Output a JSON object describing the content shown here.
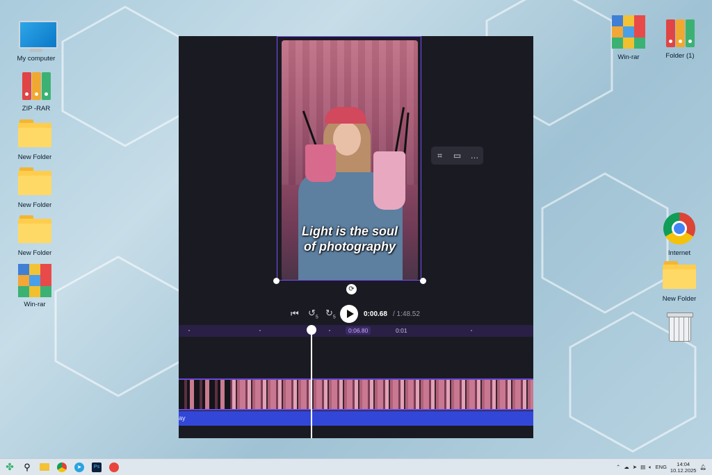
{
  "desktop": {
    "left_icons": [
      {
        "label": "My computer",
        "icon": "computer-icon"
      },
      {
        "label": "ZIP -RAR",
        "icon": "archive-binders-icon"
      },
      {
        "label": "New Folder",
        "icon": "folder-icon"
      },
      {
        "label": "New Folder",
        "icon": "folder-icon"
      },
      {
        "label": "New Folder",
        "icon": "folder-icon"
      },
      {
        "label": "Win-rar",
        "icon": "winrar-icon"
      }
    ],
    "right_icons": [
      {
        "label": "Win-rar",
        "icon": "winrar-icon"
      },
      {
        "label": "Folder (1)",
        "icon": "archive-binders-icon"
      },
      {
        "label": "Internet",
        "icon": "chrome-icon"
      },
      {
        "label": "New Folder",
        "icon": "folder-icon"
      },
      {
        "label": "",
        "icon": "recycle-bin-icon"
      }
    ]
  },
  "editor": {
    "caption_line1": "Light is the soul",
    "caption_line2": "of photography",
    "context_toolbar": {
      "crop": "crop-icon",
      "fit": "fit-icon",
      "more": "…"
    },
    "playback": {
      "current": "0:00.68",
      "total": "/ 1:48.52",
      "rewind_label": "5",
      "forward_label": "5"
    },
    "ruler": {
      "current_marker": "0:06.80",
      "mark": "0:01"
    },
    "audio_track_label": "ay",
    "accent_color": "#7c4dff"
  },
  "taskbar": {
    "apps": [
      "start-icon",
      "search-icon",
      "file-explorer-icon",
      "chrome-icon",
      "telegram-icon",
      "photoshop-icon",
      "app-icon"
    ],
    "tray": {
      "lang": "ENG",
      "time": "14:04",
      "date": "10.12.2025"
    }
  }
}
